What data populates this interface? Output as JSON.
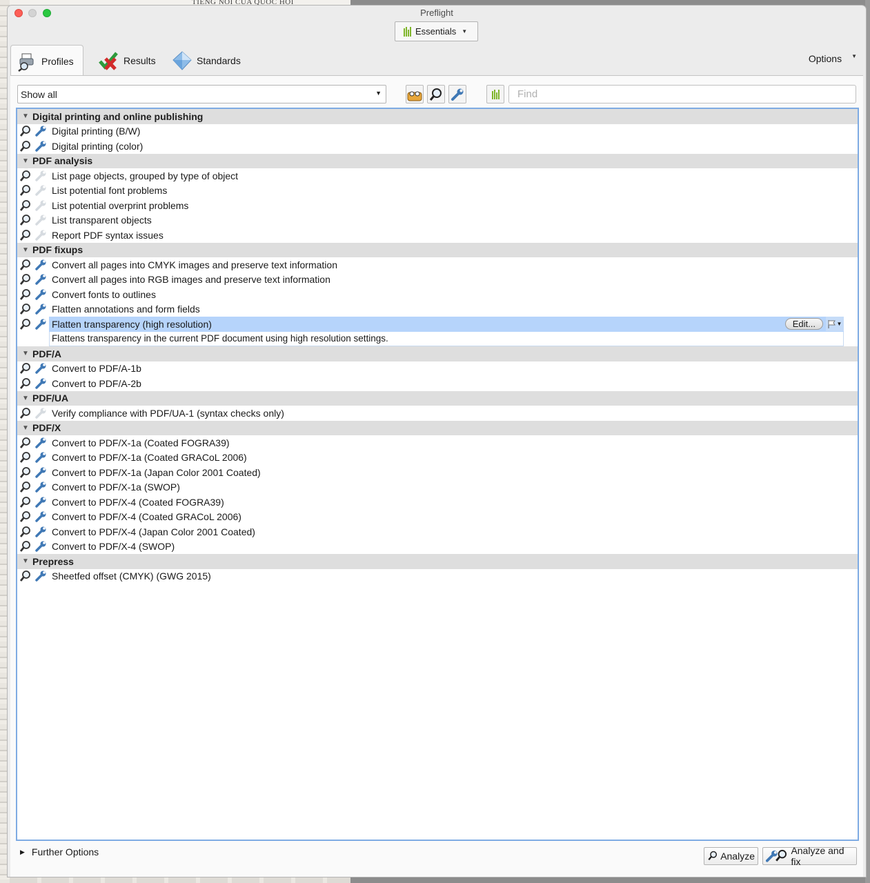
{
  "background": {
    "newspaper_title": "TIẾNG NÓI CỦA QUỐC HỘI"
  },
  "window": {
    "title": "Preflight",
    "library_button": "Essentials"
  },
  "tabs": [
    {
      "label": "Profiles",
      "icon": "profiles-icon",
      "active": true
    },
    {
      "label": "Results",
      "icon": "results-checkmark-icon",
      "active": false
    },
    {
      "label": "Standards",
      "icon": "standards-diamond-icon",
      "active": false
    }
  ],
  "options_label": "Options",
  "toolbar": {
    "filter_value": "Show all",
    "find_placeholder": "Find"
  },
  "groups": [
    {
      "name": "Digital printing and online publishing",
      "items": [
        {
          "label": "Digital printing (B/W)",
          "fixup": true
        },
        {
          "label": "Digital printing (color)",
          "fixup": true
        }
      ]
    },
    {
      "name": "PDF analysis",
      "items": [
        {
          "label": "List page objects, grouped by type of object",
          "fixup": false
        },
        {
          "label": "List potential font problems",
          "fixup": false
        },
        {
          "label": "List potential overprint problems",
          "fixup": false
        },
        {
          "label": "List transparent objects",
          "fixup": false
        },
        {
          "label": "Report PDF syntax issues",
          "fixup": false
        }
      ]
    },
    {
      "name": "PDF fixups",
      "items": [
        {
          "label": "Convert all pages into CMYK images and preserve text information",
          "fixup": true
        },
        {
          "label": "Convert all pages into RGB images and preserve text information",
          "fixup": true
        },
        {
          "label": "Convert fonts to outlines",
          "fixup": true
        },
        {
          "label": "Flatten annotations and form fields",
          "fixup": true
        },
        {
          "label": "Flatten transparency (high resolution)",
          "fixup": true,
          "selected": true,
          "description": "Flattens transparency in the current PDF document using high resolution settings.",
          "edit_label": "Edit..."
        }
      ]
    },
    {
      "name": "PDF/A",
      "items": [
        {
          "label": "Convert to PDF/A-1b",
          "fixup": true
        },
        {
          "label": "Convert to PDF/A-2b",
          "fixup": true
        }
      ]
    },
    {
      "name": "PDF/UA",
      "items": [
        {
          "label": "Verify compliance with PDF/UA-1 (syntax checks only)",
          "fixup": false
        }
      ]
    },
    {
      "name": "PDF/X",
      "items": [
        {
          "label": "Convert to PDF/X-1a (Coated FOGRA39)",
          "fixup": true
        },
        {
          "label": "Convert to PDF/X-1a (Coated GRACoL 2006)",
          "fixup": true
        },
        {
          "label": "Convert to PDF/X-1a (Japan Color 2001 Coated)",
          "fixup": true
        },
        {
          "label": "Convert to PDF/X-1a (SWOP)",
          "fixup": true
        },
        {
          "label": "Convert to PDF/X-4 (Coated FOGRA39)",
          "fixup": true
        },
        {
          "label": "Convert to PDF/X-4 (Coated GRACoL 2006)",
          "fixup": true
        },
        {
          "label": "Convert to PDF/X-4 (Japan Color 2001 Coated)",
          "fixup": true
        },
        {
          "label": "Convert to PDF/X-4 (SWOP)",
          "fixup": true
        }
      ]
    },
    {
      "name": "Prepress",
      "items": [
        {
          "label": "Sheetfed offset (CMYK) (GWG 2015)",
          "fixup": true
        }
      ]
    }
  ],
  "footer": {
    "further_options": "Further Options",
    "analyze": "Analyze",
    "analyze_and_fix": "Analyze and fix"
  },
  "colors": {
    "selection": "#b6d4fb",
    "list_border": "#7eabe3",
    "group_header": "#dedede",
    "essentials_green": "#7fb52a",
    "wrench_blue": "#3f78b5"
  }
}
